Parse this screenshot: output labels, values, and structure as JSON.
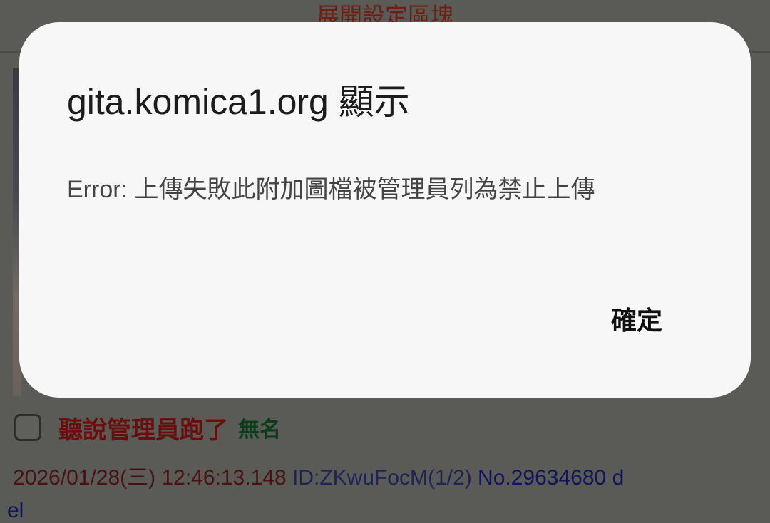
{
  "background_page": {
    "settings_toggle_label": "展開設定區塊",
    "post": {
      "subject": "聽說管理員跑了",
      "poster_name": "無名",
      "datetime": "2026/01/28(三) 12:46:13.148",
      "poster_id": "ID:ZKwuFocM(1/2)",
      "post_number": "No.29634680",
      "delete_label_part1": "d",
      "delete_label_part2": "el"
    }
  },
  "dialog": {
    "title": "gita.komica1.org 顯示",
    "message": "Error: 上傳失敗此附加圖檔被管理員列為禁止上傳",
    "ok_label": "確定"
  },
  "colors": {
    "overlay_dim": "#5a5a56",
    "dialog_bg": "#f7f7f7",
    "subject": "#6b0d0d",
    "poster": "#0c3d1a",
    "link": "#10155c"
  }
}
